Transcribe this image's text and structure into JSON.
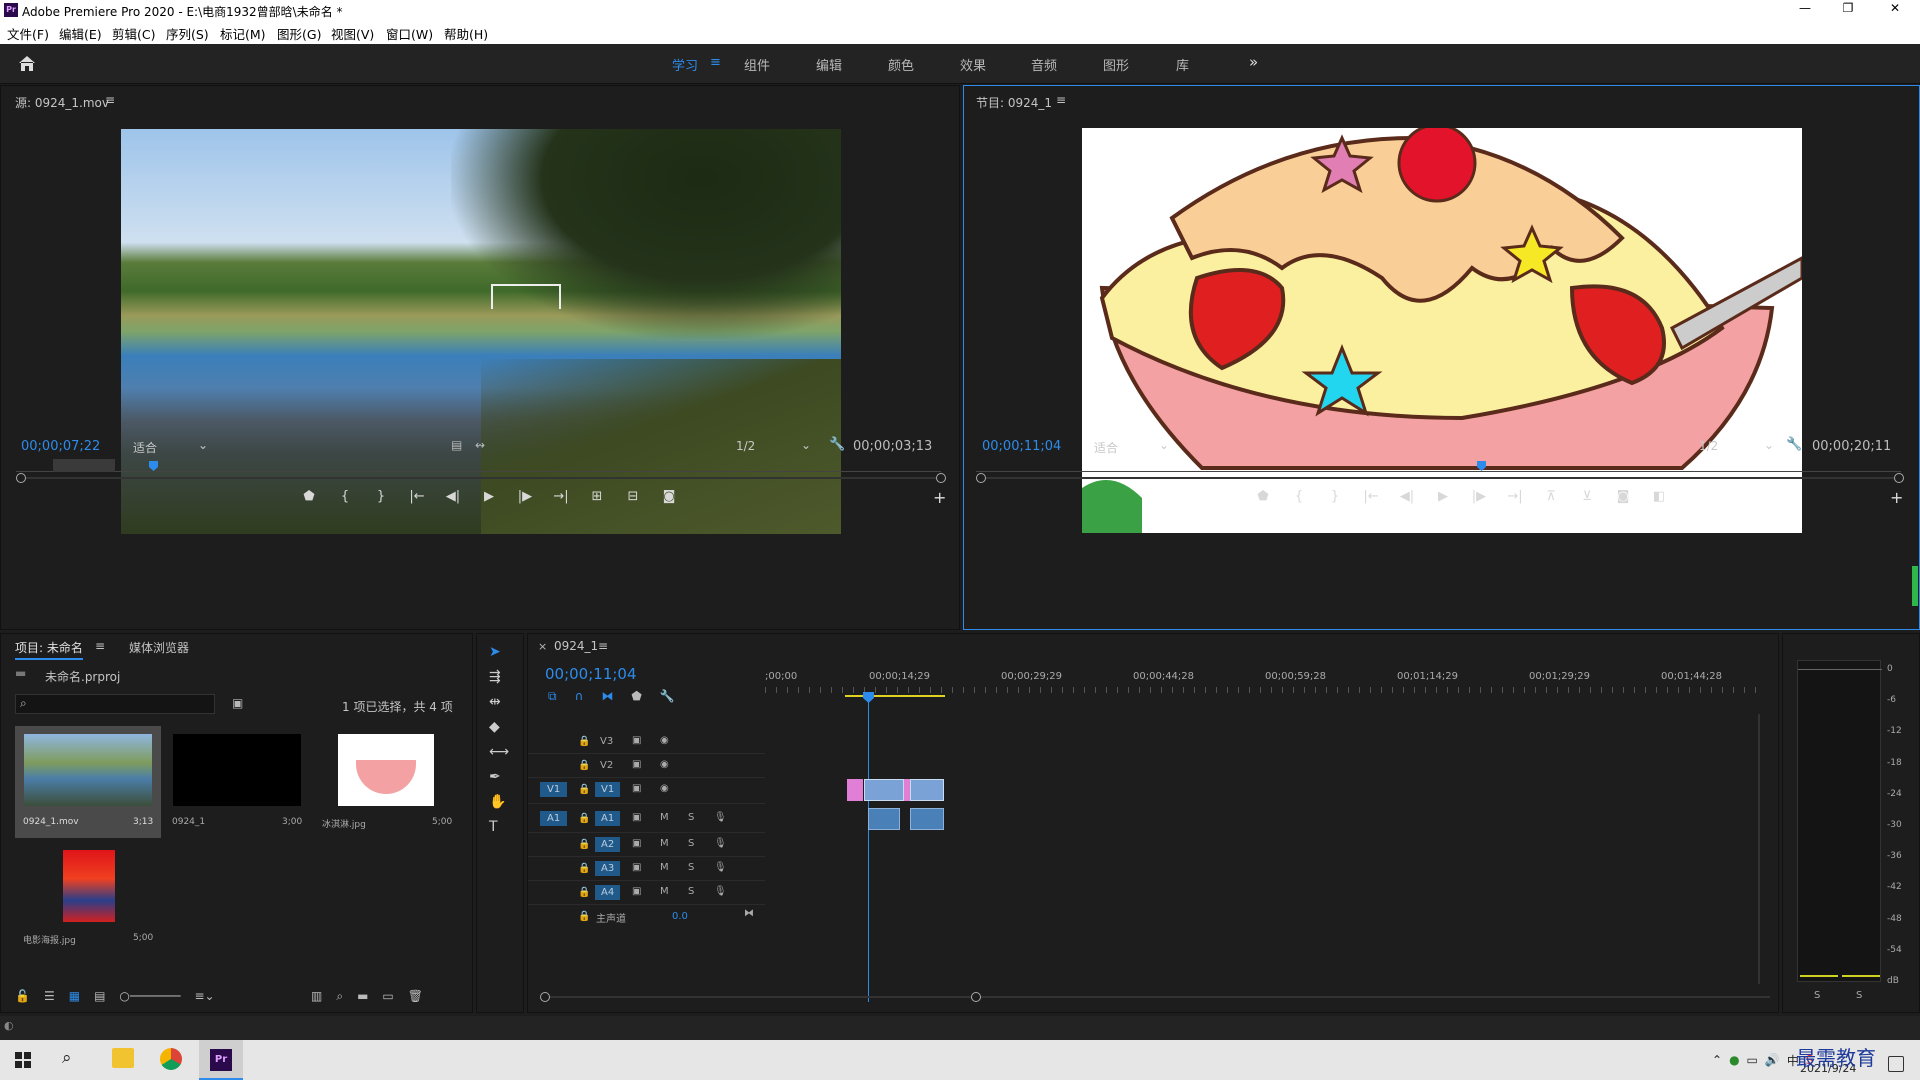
{
  "app": {
    "icon": "Pr",
    "title": "Adobe Premiere Pro 2020 - E:\\电商1932曾部晗\\未命名 *"
  },
  "window_controls": [
    "—",
    "❐",
    "✕"
  ],
  "menu": [
    "文件(F)",
    "编辑(E)",
    "剪辑(C)",
    "序列(S)",
    "标记(M)",
    "图形(G)",
    "视图(V)",
    "窗口(W)",
    "帮助(H)"
  ],
  "workspaces": {
    "active": "学习",
    "items": [
      "组件",
      "编辑",
      "颜色",
      "效果",
      "音频",
      "图形",
      "库"
    ],
    "more": "»"
  },
  "source": {
    "title": "源: 0924_1.mov",
    "timecode_left": "00;00;07;22",
    "fit": "适合",
    "res": "1/2",
    "timecode_right": "00;00;03;13"
  },
  "program": {
    "title": "节目: 0924_1",
    "timecode_left": "00;00;11;04",
    "fit": "适合",
    "res": "1/2",
    "timecode_right": "00;00;20;11"
  },
  "project": {
    "tab": "项目: 未命名",
    "tab2": "媒体浏览器",
    "file": "未命名.prproj",
    "status": "1 项已选择，共 4 项",
    "items": [
      {
        "name": "0924_1.mov",
        "dur": "3;13"
      },
      {
        "name": "0924_1",
        "dur": "3;00"
      },
      {
        "name": "冰淇淋.jpg",
        "dur": "5;00"
      },
      {
        "name": "电影海报.jpg",
        "dur": "5;00"
      }
    ]
  },
  "timeline": {
    "tab": "0924_1",
    "timecode": "00;00;11;04",
    "ruler": [
      ";00;00",
      "00;00;14;29",
      "00;00;29;29",
      "00;00;44;28",
      "00;00;59;28",
      "00;01;14;29",
      "00;01;29;29",
      "00;01;44;28"
    ],
    "video_tracks": [
      "V3",
      "V2",
      "V1"
    ],
    "audio_tracks": [
      "A1",
      "A2",
      "A3",
      "A4"
    ],
    "src_v": "V1",
    "src_a": "A1",
    "master": "主声道",
    "master_val": "0.0",
    "m": "M",
    "s": "S"
  },
  "meter": {
    "ticks": [
      "0",
      "-6",
      "-12",
      "-18",
      "-24",
      "-30",
      "-36",
      "-42",
      "-48",
      "-54",
      "dB"
    ],
    "s": "S"
  },
  "tray": {
    "time": "",
    "date": "2021/9/24",
    "ime": "中",
    "watermark": "最需教育"
  }
}
